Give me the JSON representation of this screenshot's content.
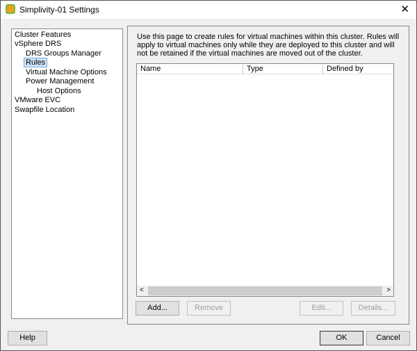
{
  "window": {
    "title": "Simplivity-01 Settings",
    "close": "✕"
  },
  "tree": {
    "items": [
      {
        "label": "Cluster Features"
      },
      {
        "label": "vSphere DRS"
      },
      {
        "label": "DRS Groups Manager"
      },
      {
        "label": "Rules",
        "selected": true
      },
      {
        "label": "Virtual Machine Options"
      },
      {
        "label": "Power Management"
      },
      {
        "label": "Host Options"
      },
      {
        "label": "VMware EVC"
      },
      {
        "label": "Swapfile Location"
      }
    ]
  },
  "main": {
    "description": "Use this page to create rules for virtual machines within this cluster. Rules will apply to virtual machines only while they are deployed to this cluster and will not be retained if the virtual machines are moved out of the cluster.",
    "columns": [
      "Name",
      "Type",
      "Defined by"
    ],
    "scroll_left": "<",
    "scroll_right": ">",
    "buttons": {
      "add": "Add...",
      "remove": "Remove",
      "edit": "Edit...",
      "details": "Details..."
    }
  },
  "footer": {
    "help": "Help",
    "ok": "OK",
    "cancel": "Cancel"
  }
}
